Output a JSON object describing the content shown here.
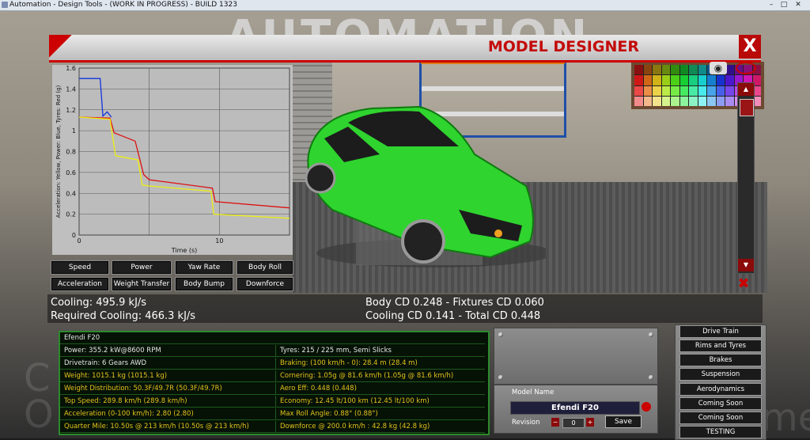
{
  "window": {
    "title": "Automation - Design Tools - (WORK IN PROGRESS) - BUILD 1323",
    "controls": [
      "–",
      "□",
      "✕"
    ]
  },
  "scene": {
    "logo_text": "AUTOMATION",
    "ghost_left": "C\nO",
    "ghost_right": "me"
  },
  "header": {
    "title": "MODEL DESIGNER",
    "close_label": "X"
  },
  "chart_data": {
    "type": "line",
    "xlabel": "Time (s)",
    "ylabel": "Acceleration: Yellow, Power: Blue, Tyres: Red (g)",
    "xlim": [
      0,
      15
    ],
    "ylim": [
      0,
      1.6
    ],
    "x_ticks": [
      "0",
      "10"
    ],
    "y_ticks": [
      "0",
      "0.2",
      "0.4",
      "0.6",
      "0.8",
      "1",
      "1.2",
      "1.4",
      "1.6"
    ],
    "grid": true,
    "series": [
      {
        "color": "#1133dd",
        "points": [
          [
            0,
            1.5
          ],
          [
            1.5,
            1.5
          ],
          [
            1.7,
            1.14
          ],
          [
            2.0,
            1.18
          ],
          [
            2.3,
            1.13
          ]
        ]
      },
      {
        "color": "#dd1111",
        "points": [
          [
            0,
            1.13
          ],
          [
            2.2,
            1.12
          ],
          [
            2.5,
            0.98
          ],
          [
            4.0,
            0.9
          ],
          [
            4.6,
            0.58
          ],
          [
            5.0,
            0.53
          ],
          [
            9.5,
            0.45
          ],
          [
            9.7,
            0.32
          ],
          [
            15,
            0.26
          ]
        ]
      },
      {
        "color": "#eeee11",
        "points": [
          [
            0,
            1.13
          ],
          [
            2.2,
            1.11
          ],
          [
            2.6,
            0.76
          ],
          [
            4.2,
            0.72
          ],
          [
            4.5,
            0.48
          ],
          [
            5.0,
            0.47
          ],
          [
            9.4,
            0.42
          ],
          [
            9.6,
            0.2
          ],
          [
            15,
            0.16
          ]
        ]
      }
    ]
  },
  "graph_buttons": [
    [
      "Speed",
      "Power",
      "Yaw Rate",
      "Body Roll"
    ],
    [
      "Acceleration",
      "Weight Transfer",
      "Body Bump",
      "Downforce"
    ]
  ],
  "cooling": {
    "line1": "Cooling: 495.9 kJ/s",
    "line2": "Required Cooling: 466.3 kJ/s"
  },
  "aero": {
    "line1": "Body CD 0.248 - Fixtures CD 0.060",
    "line2": "Cooling CD 0.141 - Total CD 0.448"
  },
  "info": {
    "name": "Efendi F20",
    "rows": [
      {
        "left": "Power: 355.2 kW@8600 RPM",
        "left_color": "w",
        "right": "Tyres: 215 / 225 mm, Semi Slicks",
        "right_color": "w"
      },
      {
        "left": "Drivetrain: 6 Gears AWD",
        "left_color": "w",
        "right": "Braking: (100 km/h - 0): 28.4 m (28.4 m)",
        "right_color": "y"
      },
      {
        "left": "Weight: 1015.1 kg (1015.1 kg)",
        "left_color": "y",
        "right": "Cornering: 1.05g @ 81.6 km/h (1.05g @ 81.6 km/h)",
        "right_color": "y"
      },
      {
        "left": "Weight Distribution: 50.3F/49.7R (50.3F/49.7R)",
        "left_color": "y",
        "right": "Aero Eff: 0.448 (0.448)",
        "right_color": "y"
      },
      {
        "left": "Top Speed: 289.8 km/h (289.8 km/h)",
        "left_color": "y",
        "right": "Economy: 12.45 lt/100 km (12.45 lt/100 km)",
        "right_color": "y"
      },
      {
        "left": "Acceleration (0-100 km/h): 2.80 (2.80)",
        "left_color": "y",
        "right": "Max Roll Angle: 0.88° (0.88°)",
        "right_color": "y"
      },
      {
        "left": "Quarter Mile: 10.50s @ 213 km/h (10.50s @ 213 km/h)",
        "left_color": "y",
        "right": "Downforce @ 200.0 km/h : 42.8 kg (42.8 kg)",
        "right_color": "y"
      }
    ]
  },
  "model": {
    "label": "Model Name",
    "value": "Efendi F20",
    "revision_label": "Revision",
    "revision_value": "0",
    "save_label": "Save"
  },
  "side_buttons": [
    "Drive Train",
    "Rims and Tyres",
    "Brakes",
    "Suspension",
    "Aerodynamics",
    "Coming Soon",
    "Coming Soon",
    "TESTING"
  ],
  "colors": {
    "accent": "#c30b0b",
    "car": "#2fd42f",
    "info_border": "#2c8a2c",
    "info_yellow": "#e3c21c"
  }
}
